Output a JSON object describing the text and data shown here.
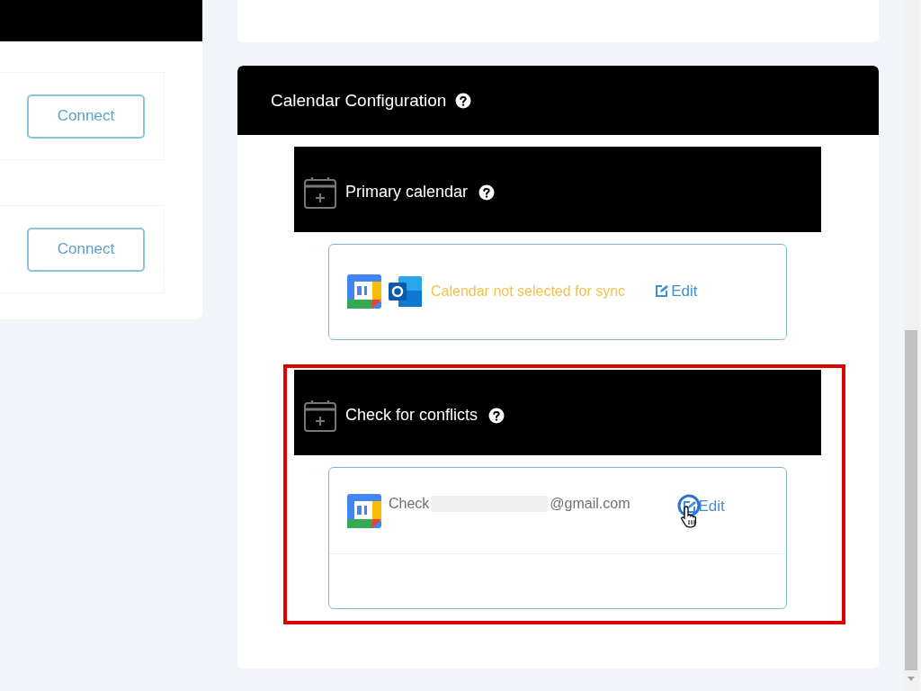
{
  "connect_panel": {
    "buttons": [
      {
        "label": "Connect"
      },
      {
        "label": "Connect"
      }
    ]
  },
  "calendar_configuration": {
    "title": "Calendar Configuration",
    "sections": [
      {
        "title": "Primary calendar",
        "highlighted": false,
        "entry": {
          "kind": "status",
          "providers": [
            {
              "kind": "google"
            },
            {
              "kind": "outlook"
            }
          ],
          "text": "Calendar not selected for sync",
          "edit_label": "Edit",
          "hovered": false
        }
      },
      {
        "title": "Check for conflicts",
        "highlighted": true,
        "entry": {
          "kind": "account",
          "providers": [
            {
              "kind": "google"
            }
          ],
          "prefix": "Check",
          "suffix": "@gmail.com",
          "edit_label": "Edit",
          "hovered": true
        }
      }
    ]
  }
}
